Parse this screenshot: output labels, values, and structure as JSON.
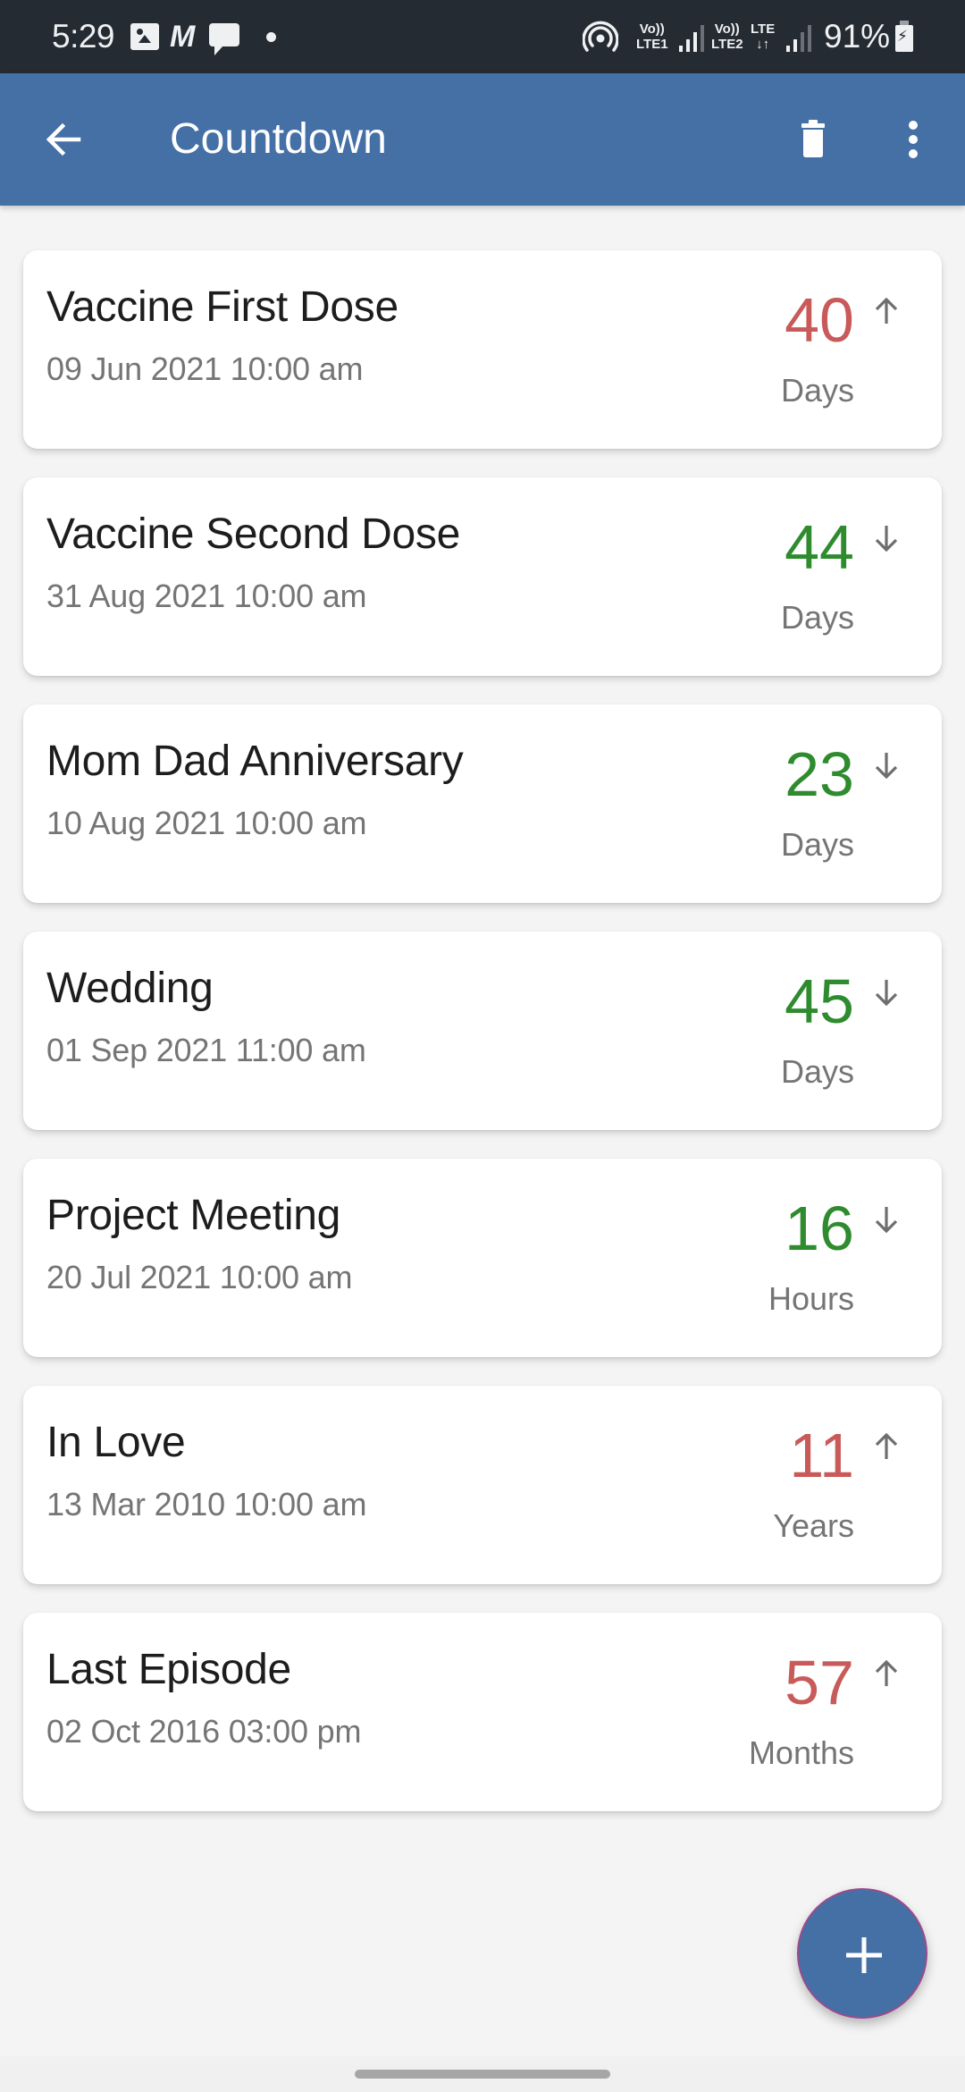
{
  "status_bar": {
    "time": "5:29",
    "icons": [
      "gallery-icon",
      "m-app-icon",
      "message-icon",
      "dot-icon",
      "hotspot-icon"
    ],
    "sim1": {
      "top": "Vo))",
      "bottom": "LTE1"
    },
    "sim2": {
      "top": "Vo))",
      "bottom": "LTE2"
    },
    "sim2_data": {
      "top": "LTE",
      "bottom": "↓↑"
    },
    "battery": "91%"
  },
  "app_bar": {
    "title": "Countdown",
    "back_icon": "arrow-left-icon",
    "actions": [
      "trash-icon",
      "more-vert-icon"
    ]
  },
  "colors": {
    "primary": "#4470a6",
    "status_bar": "#252b33",
    "count_past": "#c85a5a",
    "count_future": "#2e8b2e",
    "secondary_text": "#757575",
    "background": "#f4f4f4"
  },
  "events": [
    {
      "name": "Vaccine First Dose",
      "date": "09 Jun 2021 10:00 am",
      "count": "40",
      "unit": "Days",
      "direction": "up"
    },
    {
      "name": "Vaccine Second Dose",
      "date": "31 Aug 2021 10:00 am",
      "count": "44",
      "unit": "Days",
      "direction": "down"
    },
    {
      "name": "Mom Dad Anniversary",
      "date": "10 Aug 2021 10:00 am",
      "count": "23",
      "unit": "Days",
      "direction": "down"
    },
    {
      "name": "Wedding",
      "date": "01 Sep 2021 11:00 am",
      "count": "45",
      "unit": "Days",
      "direction": "down"
    },
    {
      "name": "Project Meeting",
      "date": "20 Jul 2021 10:00 am",
      "count": "16",
      "unit": "Hours",
      "direction": "down"
    },
    {
      "name": "In Love",
      "date": "13 Mar 2010 10:00 am",
      "count": "11",
      "unit": "Years",
      "direction": "up"
    },
    {
      "name": "Last Episode",
      "date": "02 Oct 2016 03:00 pm",
      "count": "57",
      "unit": "Months",
      "direction": "up"
    }
  ],
  "fab": {
    "icon": "plus-icon",
    "label": "Add event"
  }
}
